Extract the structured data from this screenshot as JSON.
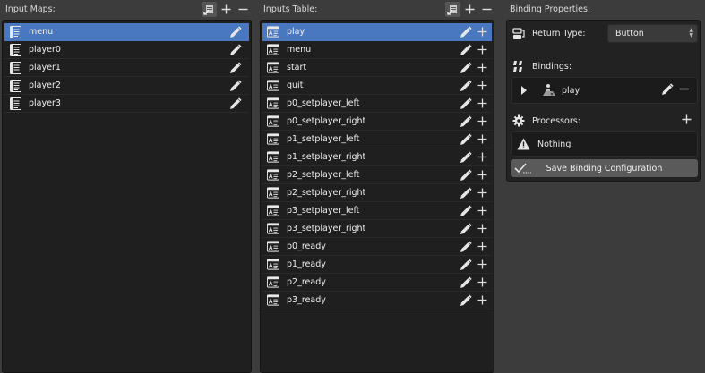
{
  "input_maps": {
    "title": "Input Maps:",
    "items": [
      "menu",
      "player0",
      "player1",
      "player2",
      "player3"
    ],
    "selected_index": 0
  },
  "inputs_table": {
    "title": "Inputs Table:",
    "items": [
      "play",
      "menu",
      "start",
      "quit",
      "p0_setplayer_left",
      "p0_setplayer_right",
      "p1_setplayer_left",
      "p1_setplayer_right",
      "p2_setplayer_left",
      "p2_setplayer_right",
      "p3_setplayer_left",
      "p3_setplayer_right",
      "p0_ready",
      "p1_ready",
      "p2_ready",
      "p3_ready"
    ],
    "selected_index": 0
  },
  "binding_properties": {
    "title": "Binding Properties:",
    "return_type_label": "Return Type:",
    "return_type_value": "Button",
    "bindings_label": "Bindings:",
    "binding_item": "play",
    "processors_label": "Processors:",
    "processors_empty": "Nothing",
    "save_label": "Save Binding Configuration"
  },
  "colors": {
    "selection": "#4a78c0",
    "panel_bg": "#3c3c3c",
    "list_bg": "#1f1f1f"
  }
}
